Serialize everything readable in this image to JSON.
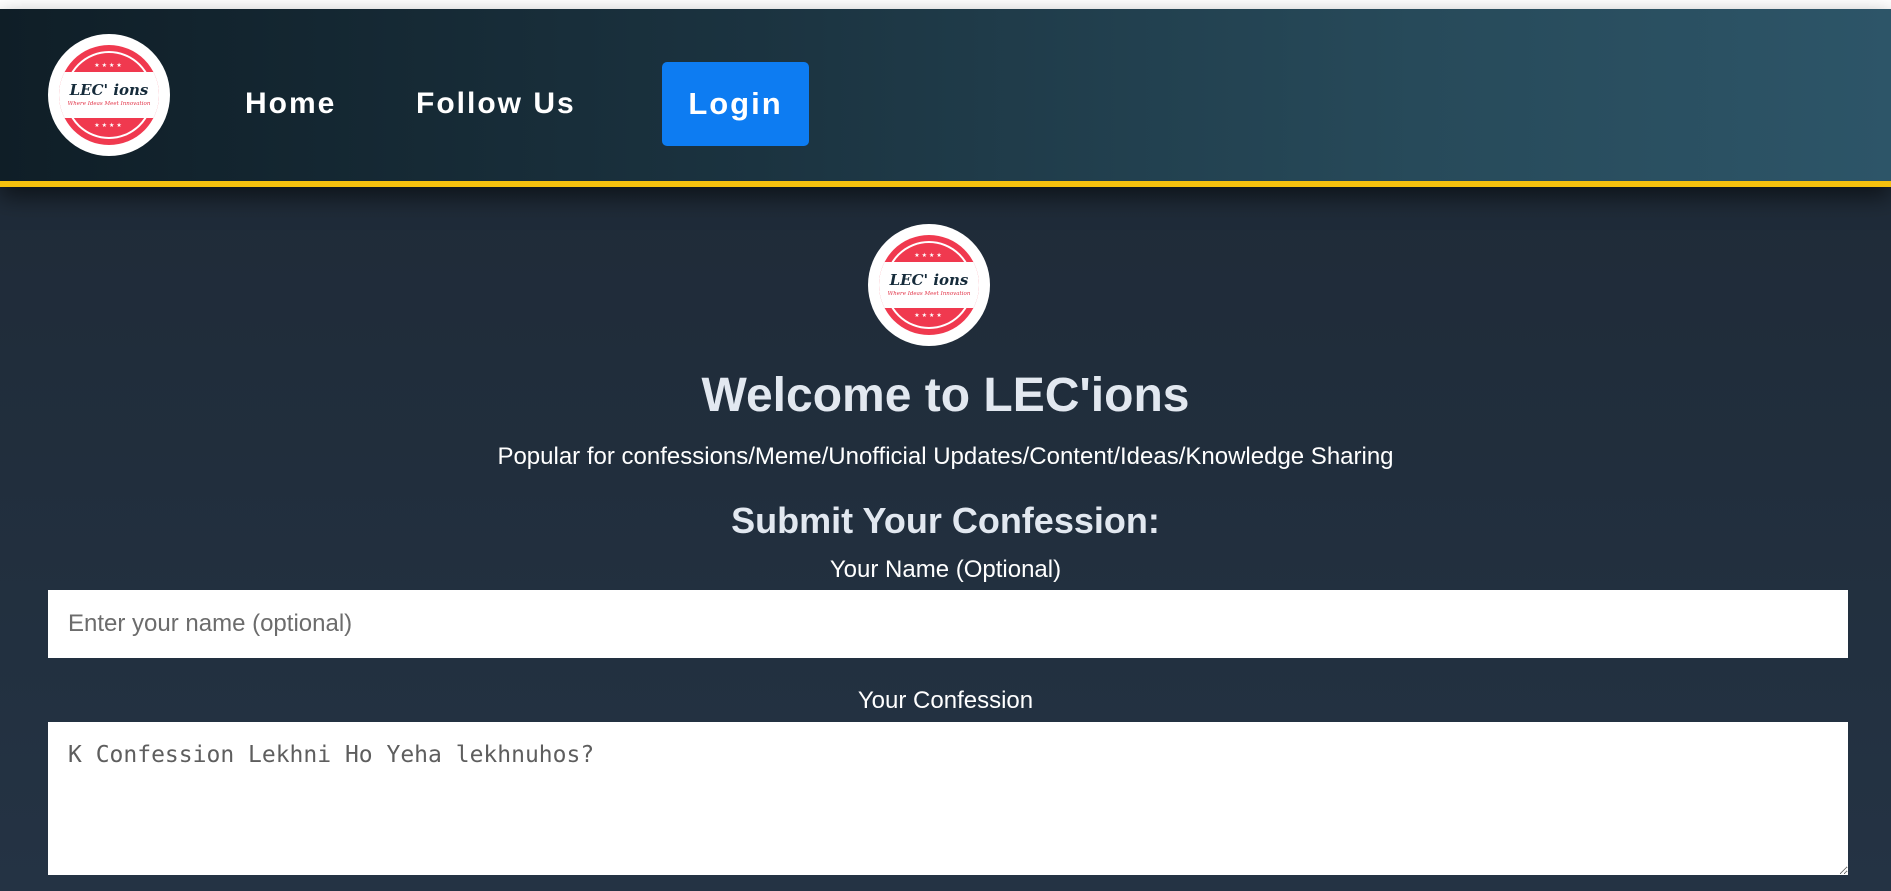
{
  "brand": {
    "logo_text": "LEC' ions",
    "logo_tagline": "Where Ideas Meet Innovation",
    "logo_stars": "★★★★"
  },
  "nav": {
    "home": "Home",
    "follow_us": "Follow Us",
    "login": "Login"
  },
  "main": {
    "welcome": "Welcome to LEC'ions",
    "subtitle": "Popular for confessions/Meme/Unofficial Updates/Content/Ideas/Knowledge Sharing"
  },
  "form": {
    "title": "Submit Your Confession:",
    "name_label": "Your Name (Optional)",
    "name_placeholder": "Enter your name (optional)",
    "name_value": "",
    "confession_label": "Your Confession",
    "confession_placeholder": "K Confession Lekhni Ho Yeha lekhnuhos?",
    "confession_value": ""
  },
  "colors": {
    "accent": "#0d7cf2",
    "nav_border": "#f5c10e",
    "logo_red": "#f0394f",
    "logo_navy": "#152b3a"
  }
}
